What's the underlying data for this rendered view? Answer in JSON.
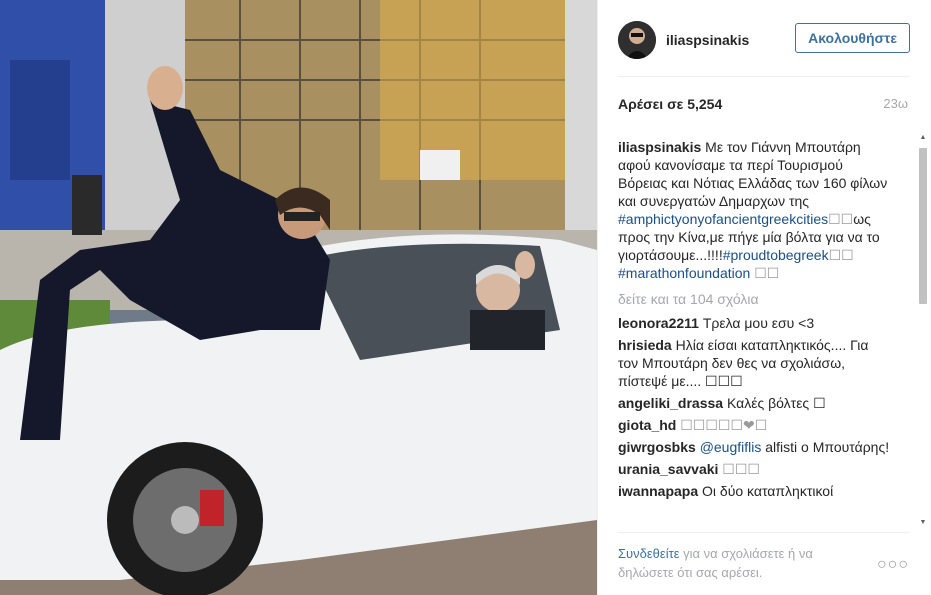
{
  "post": {
    "image_alt": "Photo of two men with a white car"
  },
  "header": {
    "username": "iliaspsinakis",
    "follow_label": "Ακολουθήστε"
  },
  "stats": {
    "likes_label": "Αρέσει σε 5,254",
    "time_ago": "23ω"
  },
  "caption": {
    "user": "iliaspsinakis",
    "text_1": "Με τον Γιάννη Μπουτάρη αφού κανονίσαμε τα περί Τουρισμού Βόρειας και Νότιας Ελλάδας των 160 φίλων και συνεργατών Δημαρχων της ",
    "tag_1": "#amphictyonyofancientgreekcities",
    "text_2": "ως προς την Κίνα,με πήγε μία βόλτα για να το γιορτάσουμε...!!!!",
    "tag_2": "#proudtobegreek",
    "tag_3": "#marathonfoundation",
    "boxes_1": "☐☐",
    "boxes_2": "☐☐",
    "boxes_3": "☐☐"
  },
  "load_more": "δείτε και τα 104 σχόλια",
  "comments": [
    {
      "user": "leonora2211",
      "text": "Τρελα μου εσυ <3"
    },
    {
      "user": "hrisieda",
      "text": "Ηλία είσαι καταπληκτικός.... Για τον Μπουτάρη δεν θες να σχολιάσω, πίστεψέ με.... ☐☐☐"
    },
    {
      "user": "angeliki_drassa",
      "text": "Καλές βόλτες ☐"
    },
    {
      "user": "giota_hd",
      "text": "☐☐☐☐☐❤☐"
    },
    {
      "user": "giwrgosbks",
      "mention": "@eugfiflis",
      "text": " alfisti ο Μπουτάρης!"
    },
    {
      "user": "urania_savvaki",
      "text": "☐☐☐"
    },
    {
      "user": "iwannapapa",
      "text": "Οι δύο καταπληκτικοί"
    }
  ],
  "footer": {
    "login_link": "Συνδεθείτε",
    "text": " για να σχολιάσετε ή να δηλώσετε ότι σας αρέσει.",
    "more_label": "○○○"
  },
  "colors": {
    "link": "#3f729b",
    "tag": "#1b4f84",
    "muted": "#a5a7aa"
  }
}
